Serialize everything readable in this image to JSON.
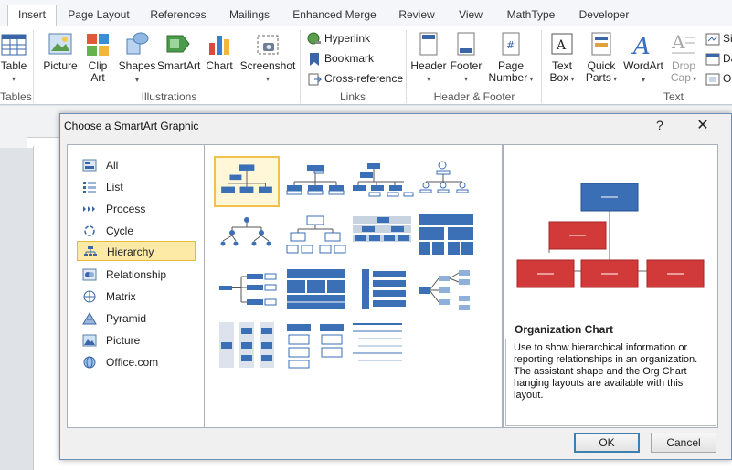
{
  "ribbon": {
    "tabs": [
      "Insert",
      "Page Layout",
      "References",
      "Mailings",
      "Enhanced Merge",
      "Review",
      "View",
      "MathType",
      "Developer"
    ],
    "active_tab": "Insert",
    "tables_group": {
      "button": "Table",
      "label": "Tables"
    },
    "illustrations_group": {
      "label": "Illustrations",
      "picture": "Picture",
      "clip_art": "Clip Art",
      "shapes": "Shapes",
      "smartart": "SmartArt",
      "chart": "Chart",
      "screenshot": "Screenshot"
    },
    "links_group": {
      "label": "Links",
      "hyperlink": "Hyperlink",
      "bookmark": "Bookmark",
      "cross_reference": "Cross-reference"
    },
    "header_footer_group": {
      "label": "Header & Footer",
      "header": "Header",
      "footer": "Footer",
      "page_number_line1": "Page",
      "page_number_line2": "Number"
    },
    "text_group": {
      "label": "Text",
      "text_box_line1": "Text",
      "text_box_line2": "Box",
      "quick_parts_line1": "Quick",
      "quick_parts_line2": "Parts",
      "wordart": "WordArt",
      "drop_cap_line1": "Drop",
      "drop_cap_line2": "Cap",
      "signature": "Si",
      "date": "Da",
      "object": "O"
    }
  },
  "dialog": {
    "title": "Choose a SmartArt Graphic",
    "help": "?",
    "close": "✕",
    "categories": [
      "All",
      "List",
      "Process",
      "Cycle",
      "Hierarchy",
      "Relationship",
      "Matrix",
      "Pyramid",
      "Picture",
      "Office.com"
    ],
    "selected_category": "Hierarchy",
    "preview": {
      "title": "Organization Chart",
      "description": "Use to show hierarchical information or reporting relationships in an organization. The assistant shape and the Org Chart hanging layouts are available with this layout."
    },
    "ok": "OK",
    "cancel": "Cancel"
  },
  "colors": {
    "accent_blue": "#3b6fb6",
    "preview_red": "#d23a3a",
    "selection": "#fdeaa6"
  }
}
